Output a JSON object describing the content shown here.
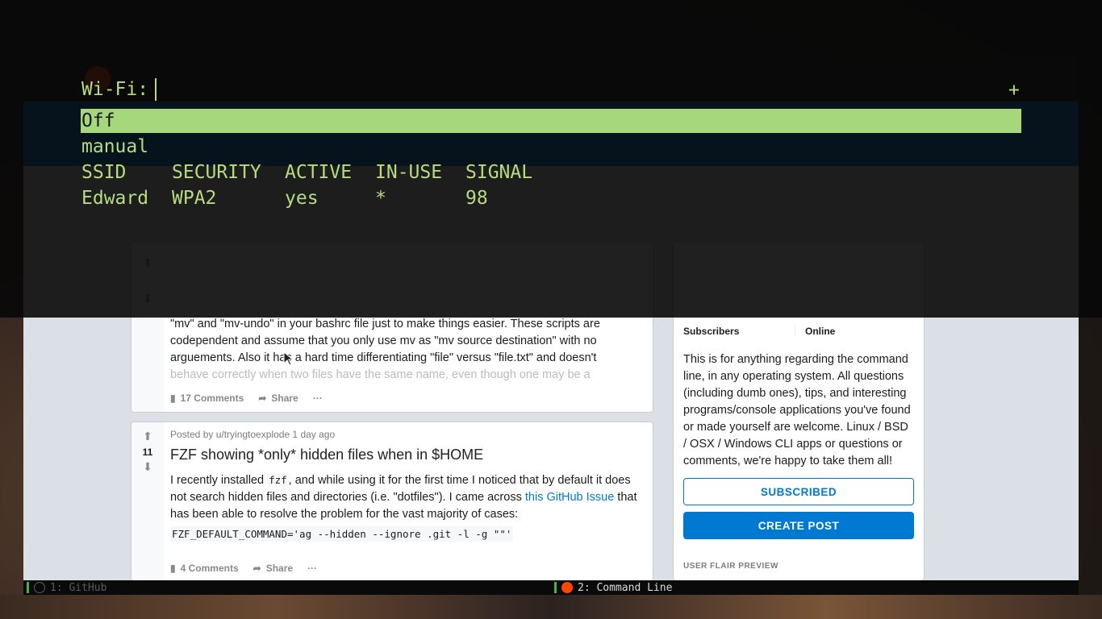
{
  "wifi_menu": {
    "prompt": "Wi-Fi:",
    "plus_label": "+",
    "options": [
      "Off",
      "manual"
    ],
    "selected_index": 0,
    "table_headers": [
      "SSID",
      "SECURITY",
      "ACTIVE",
      "IN-USE",
      "SIGNAL"
    ],
    "networks": [
      {
        "ssid": "Edward",
        "security": "WPA2",
        "active": "yes",
        "in_use": "*",
        "signal": "98"
      }
    ]
  },
  "posts": [
    {
      "text_visible": "\"mv\" and \"mv-undo\" in your bashrc file just to make things easier. These scripts are codependent and assume that you only use mv as \"mv source destination\" with no arguements. Also it has a hard time differentiating \"file\" versus \"file.txt\" and doesn't",
      "text_faded": "behave correctly when two files have the same name, even though one may be a",
      "comments_label": "17 Comments",
      "share_label": "Share",
      "more_label": "···"
    },
    {
      "meta": "Posted by u/tryingtoexplode 1 day ago",
      "votes": "11",
      "title": "FZF showing *only* hidden files when in $HOME",
      "text_1": "I recently installed ",
      "code_1": "fzf",
      "text_2": ", and while using it for the first time I noticed that by default it does not search hidden files and directories (i.e. \"dotfiles\"). I came across ",
      "link_1": "this GitHub Issue",
      "text_3": " that has been able to resolve the problem for the vast majority of cases:",
      "code_line": "FZF_DEFAULT_COMMAND='ag --hidden --ignore .git -l -g \"\"'",
      "comments_label": "4 Comments",
      "share_label": "Share",
      "more_label": "···"
    }
  ],
  "sidebar": {
    "subscribers_label": "Subscribers",
    "online_label": "Online",
    "about": "This is for anything regarding the command line, in any operating system. All questions (including dumb ones), tips, and interesting programs/console applications you've found or made yourself are welcome. Linux / BSD / OSX / Windows CLI apps or questions or comments, we're happy to take them all!",
    "subscribed_button": "SUBSCRIBED",
    "create_post_button": "CREATE POST",
    "flair_label": "USER FLAIR PREVIEW"
  },
  "taskbar": {
    "workspaces": [
      {
        "label": "1: GitHub",
        "active": false
      },
      {
        "label": "2: Command Line",
        "active": true
      }
    ]
  },
  "colors": {
    "menu_fg": "#b5dc7f",
    "menu_selected_bg": "#a7d77c",
    "reddit_blue": "#0079d3"
  }
}
